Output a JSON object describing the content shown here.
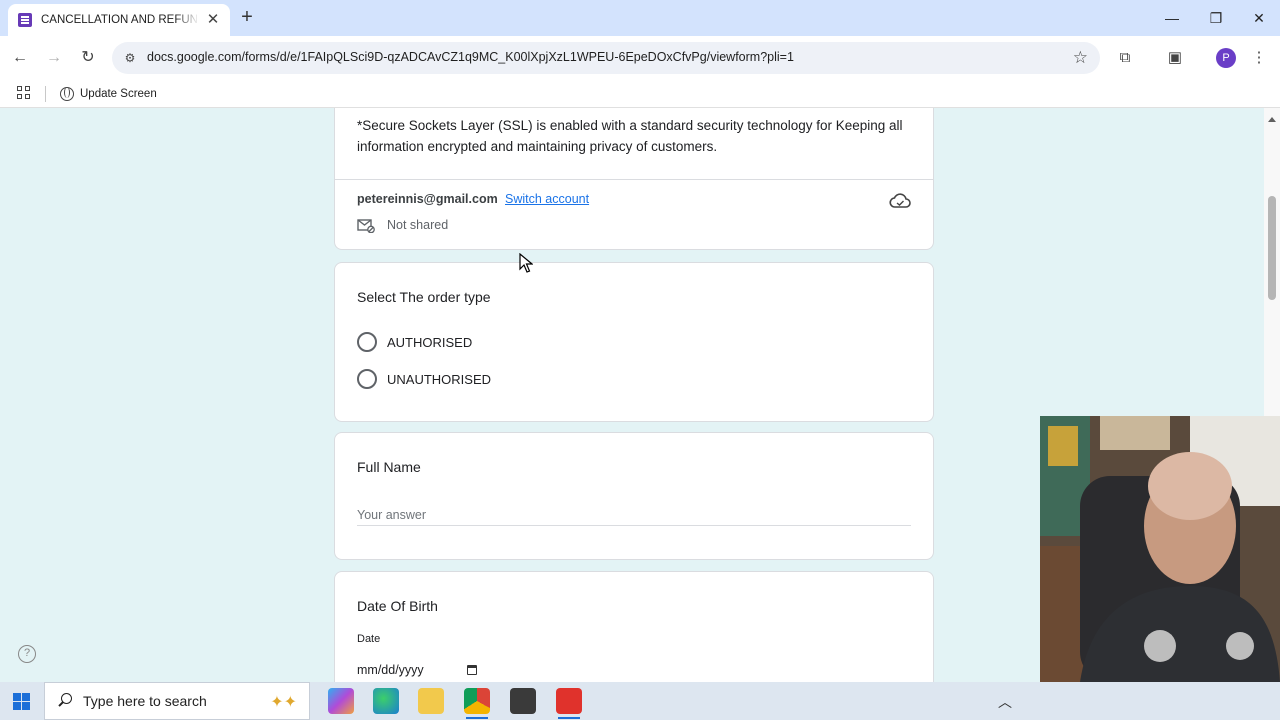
{
  "browser": {
    "tab": {
      "title": "CANCELLATION AND REFUND POLICY"
    },
    "url": "docs.google.com/forms/d/e/1FAIpQLSci9D-qzADCAvCZ1q9MC_K00lXpjXzL1WPEU-6EpeDOxCfvPg/viewform?pli=1",
    "bookmarks": [
      {
        "label": "Update Screen"
      }
    ],
    "profile_initial": "P"
  },
  "form": {
    "notice": "*Secure Sockets Layer (SSL) is enabled with a standard security technology for Keeping all information encrypted and maintaining privacy of customers.",
    "account": {
      "email": "petereinnis@gmail.com",
      "switch_label": "Switch account",
      "shared_status": "Not shared"
    },
    "questions": {
      "order_type": {
        "title": "Select The order type",
        "options": [
          "AUTHORISED",
          "UNAUTHORISED"
        ]
      },
      "full_name": {
        "title": "Full Name",
        "placeholder": "Your answer"
      },
      "dob": {
        "title": "Date Of Birth",
        "sublabel": "Date",
        "placeholder": "mm/dd/yyyy"
      }
    }
  },
  "taskbar": {
    "search_placeholder": "Type here to search"
  },
  "colors": {
    "page_bg": "#e3f3f5",
    "forms_purple": "#673ab7",
    "link_blue": "#1a73e8"
  }
}
